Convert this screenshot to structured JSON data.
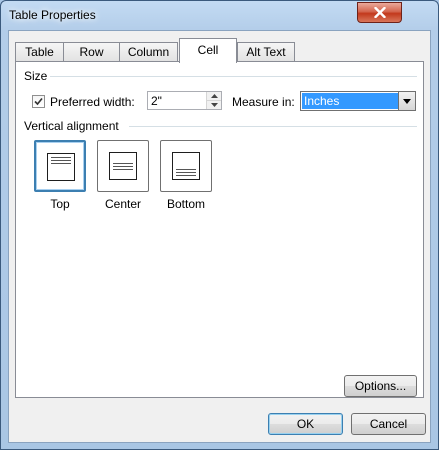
{
  "window": {
    "title": "Table Properties"
  },
  "tabs": [
    {
      "label": "Table",
      "active": false
    },
    {
      "label": "Row",
      "active": false
    },
    {
      "label": "Column",
      "active": false
    },
    {
      "label": "Cell",
      "active": true
    },
    {
      "label": "Alt Text",
      "active": false
    }
  ],
  "size_group": {
    "title": "Size",
    "preferred_width_checked": true,
    "preferred_width_label": "Preferred width:",
    "preferred_width_value": "2\"",
    "measure_label": "Measure in:",
    "measure_value": "Inches"
  },
  "vertical_alignment": {
    "title": "Vertical alignment",
    "selected": "Top",
    "options": [
      {
        "label": "Top",
        "icon": "align-top-icon"
      },
      {
        "label": "Center",
        "icon": "align-center-icon"
      },
      {
        "label": "Bottom",
        "icon": "align-bottom-icon"
      }
    ]
  },
  "buttons": {
    "options": "Options...",
    "ok": "OK",
    "cancel": "Cancel"
  },
  "colors": {
    "selection": "#3399ff",
    "close_button": "#c2391c",
    "focus_border": "#3c7fb1"
  }
}
